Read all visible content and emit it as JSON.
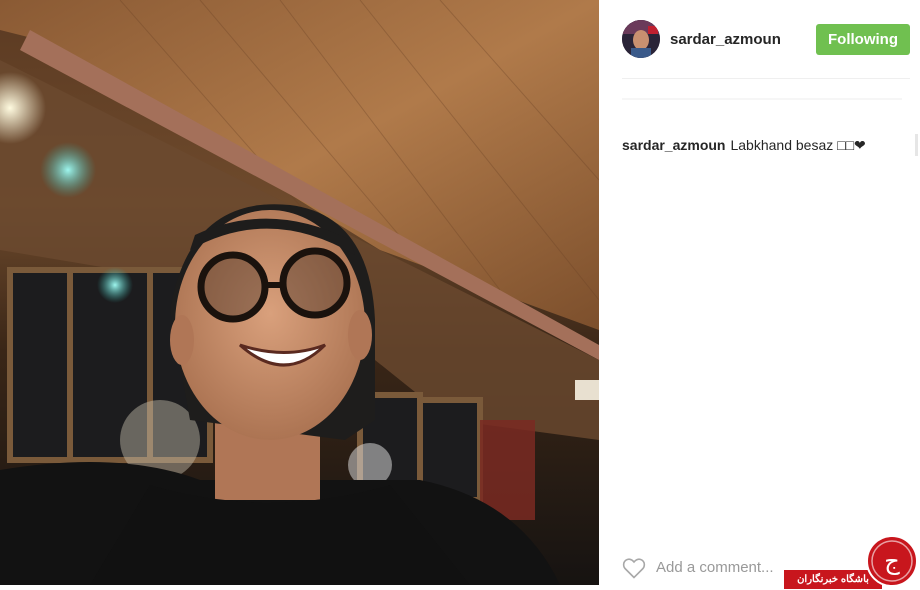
{
  "post": {
    "photo_name": "selfie-photo"
  },
  "header": {
    "username": "sardar_azmoun",
    "follow_label": "Following",
    "follow_color": "#70c050"
  },
  "caption": {
    "username": "sardar_azmoun",
    "text": "Labkhand besaz □□❤"
  },
  "comment": {
    "placeholder": "Add a comment...",
    "like_icon": "heart-outline-icon"
  },
  "watermark": {
    "label": "باشگاه خبرنگاران",
    "logo_text": "ج",
    "color": "#c8161d"
  }
}
